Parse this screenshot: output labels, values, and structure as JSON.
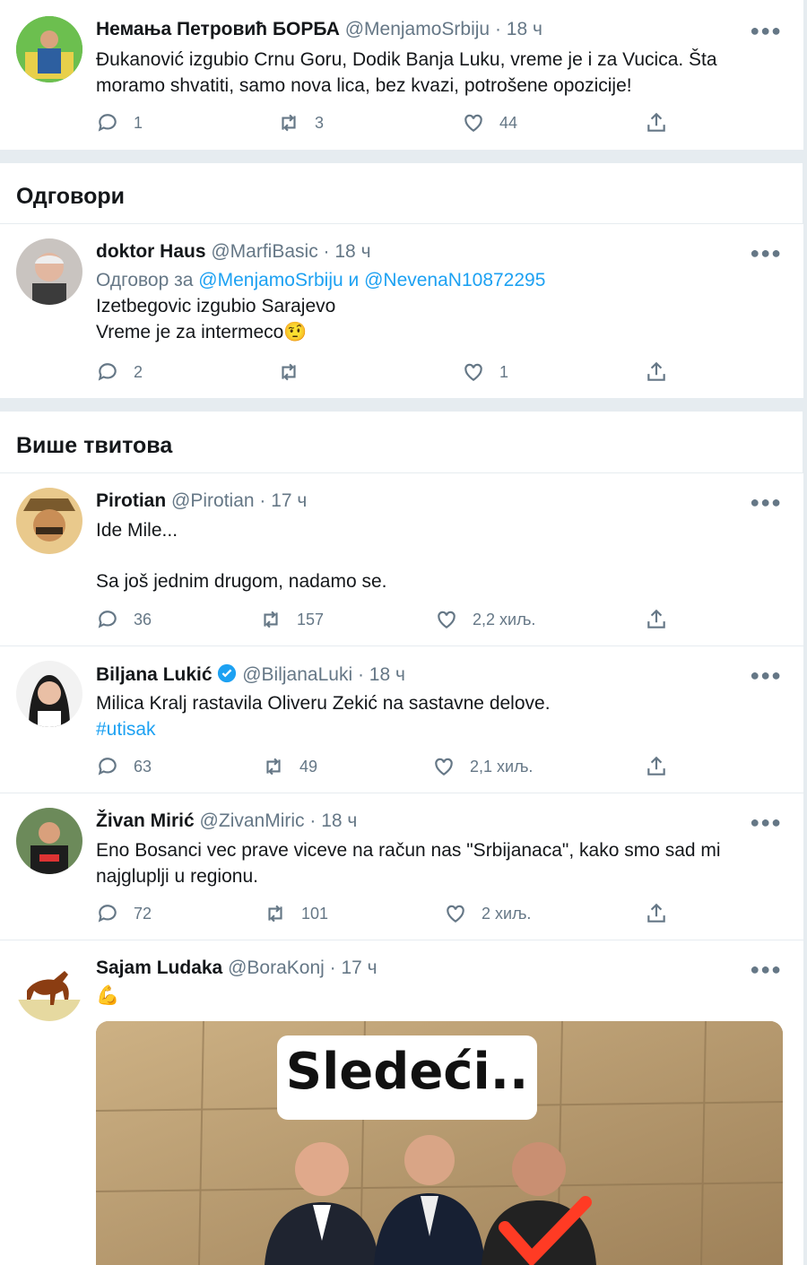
{
  "tweets": {
    "t1": {
      "name": "Немања Петровић БОРБА",
      "handle": "@MenjamoSrbiju",
      "time": "· 18 ч",
      "line1": "Đukanović izgubio Crnu Goru, Dodik Banja Luku, vreme je i za Vucica. Šta",
      "line2": "moramo shvatiti, samo nova lica, bez kvazi, potrošene opozicije!",
      "replies": "1",
      "retweets": "3",
      "likes": "44"
    },
    "t2": {
      "name": "doktor Haus",
      "handle": "@MarfiBasic",
      "time": "· 18 ч",
      "reply_prefix": "Одговор за",
      "reply_user1": "@MenjamoSrbiju",
      "reply_and": "и",
      "reply_user2": "@NevenaN10872295",
      "line1": "Izetbegovic izgubio Sarajevo",
      "line2": "Vreme je za intermeco",
      "emoji": "🤨",
      "replies": "2",
      "retweets": "",
      "likes": "1"
    },
    "t3": {
      "name": "Pirotian",
      "handle": "@Pirotian",
      "time": "· 17 ч",
      "line1": "Ide Mile...",
      "line2": "Sa još jednim drugom, nadamo se.",
      "replies": "36",
      "retweets": "157",
      "likes": "2,2 хиљ."
    },
    "t4": {
      "name": "Biljana Lukić",
      "handle": "@BiljanaLuki",
      "time": "· 18 ч",
      "line1": "Milica Kralj rastavila Oliveru Zekić na sastavne delove.",
      "hashtag": "#utisak",
      "replies": "63",
      "retweets": "49",
      "likes": "2,1 хиљ."
    },
    "t5": {
      "name": "Živan Mirić",
      "handle": "@ZivanMiric",
      "time": "· 18 ч",
      "line1": "Eno Bosanci vec prave viceve na račun nas \"Srbijanaca\", kako smo sad mi",
      "line2": "najgluplji u regionu.",
      "replies": "72",
      "retweets": "101",
      "likes": "2 хиљ."
    },
    "t6": {
      "name": "Sajam Ludaka",
      "handle": "@BoraKonj",
      "time": "· 17 ч",
      "emoji": "💪",
      "image_caption": "Sledeći.."
    }
  },
  "sections": {
    "replies_title": "Одговори",
    "more_tweets_title": "Више твитова"
  },
  "colors": {
    "link": "#1da1f2",
    "muted": "#657786",
    "separator": "#e6ecf0",
    "verified": "#1da1f2"
  },
  "icons": [
    "reply-icon",
    "retweet-icon",
    "like-icon",
    "share-icon",
    "more-icon",
    "verified-icon"
  ]
}
